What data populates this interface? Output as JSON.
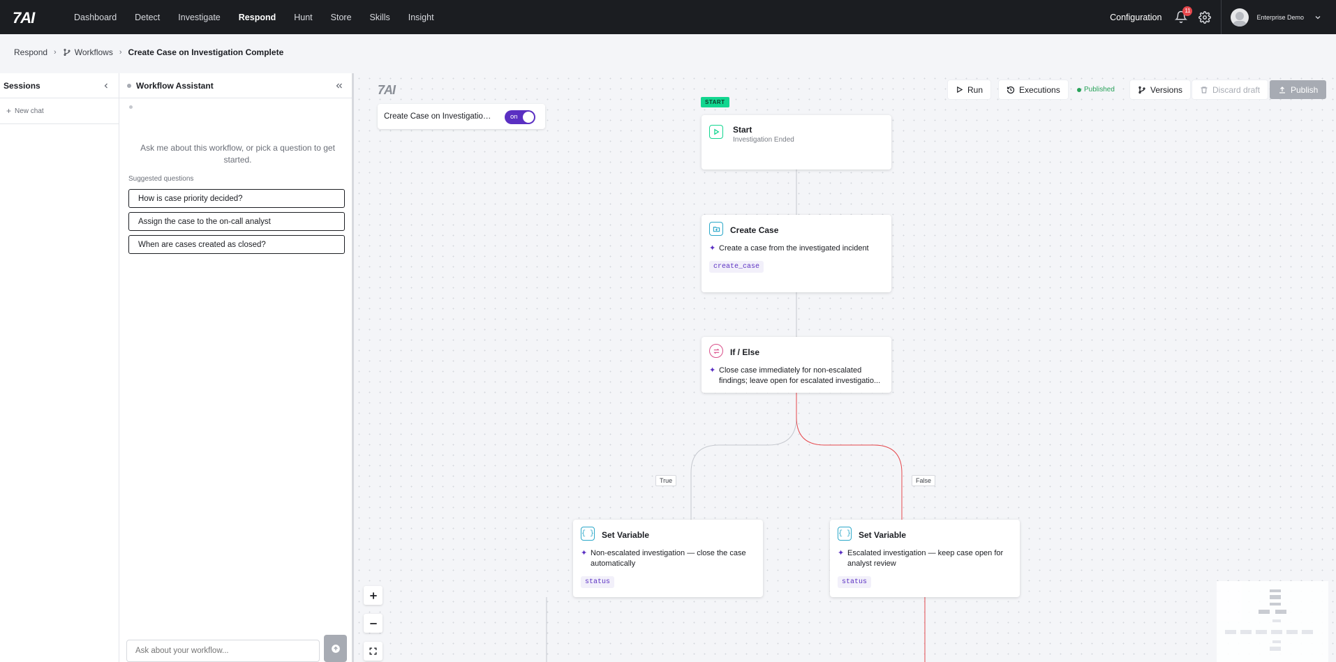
{
  "nav": {
    "logo": "7AI",
    "items": [
      "Dashboard",
      "Detect",
      "Investigate",
      "Respond",
      "Hunt",
      "Store",
      "Skills",
      "Insight"
    ],
    "active": "Respond",
    "configuration": "Configuration",
    "notification_count": "11",
    "user_name": "Enterprise Demo"
  },
  "breadcrumb": {
    "items": [
      "Respond",
      "Workflows",
      "Create Case on Investigation Complete"
    ]
  },
  "sessions": {
    "title": "Sessions",
    "new_chat": "New chat"
  },
  "assistant": {
    "title": "Workflow Assistant",
    "intro": "Ask me about this workflow, or pick a question to get started.",
    "suggested_label": "Suggested questions",
    "suggestions": [
      "How is case priority decided?",
      "Assign the case to the on-call analyst",
      "When are cases created as closed?"
    ],
    "input_placeholder": "Ask about your workflow..."
  },
  "canvas": {
    "logo": "7AI",
    "workflow_name": "Create Case on Investigation Complete",
    "toggle_label": "on",
    "toolbar": {
      "run": "Run",
      "executions": "Executions",
      "status": "Published",
      "versions": "Versions",
      "discard": "Discard draft",
      "publish": "Publish"
    },
    "start_tag": "START",
    "nodes": {
      "start": {
        "title": "Start",
        "subtitle": "Investigation Ended"
      },
      "create_case": {
        "title": "Create Case",
        "description": "Create a case from the investigated incident",
        "chip": "create_case"
      },
      "if_else": {
        "title": "If / Else",
        "description": "Close case immediately for non-escalated findings; leave open for escalated investigatio..."
      },
      "set_var_true": {
        "title": "Set Variable",
        "description": "Non-escalated investigation — close the case automatically",
        "chip": "status"
      },
      "set_var_false": {
        "title": "Set Variable",
        "description": "Escalated investigation — keep case open for analyst review",
        "chip": "status"
      }
    },
    "edge_labels": {
      "true": "True",
      "false": "False"
    },
    "colors": {
      "accent": "#5a2fc2",
      "false_edge": "#e5484d",
      "start_tag": "#12d690",
      "published": "#29a35a"
    }
  }
}
